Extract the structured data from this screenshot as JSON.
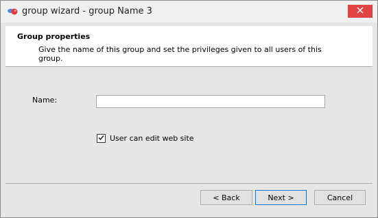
{
  "window": {
    "title": "group wizard - group Name 3",
    "icons": {
      "app": "app-logo-icon",
      "close": "close-icon"
    }
  },
  "header": {
    "title": "Group properties",
    "description": "Give the name of this group and set the privileges given to all users of this group."
  },
  "form": {
    "name_label": "Name:",
    "name_value": "",
    "edit_website_label": "User can edit web site",
    "edit_website_checked": true
  },
  "buttons": {
    "back": "< Back",
    "next": "Next >",
    "cancel": "Cancel"
  },
  "colors": {
    "close_button": "#e04343",
    "default_button_border": "#0078d7",
    "app_icon_red": "#e03a3a",
    "app_icon_blue": "#2f7fd6"
  }
}
